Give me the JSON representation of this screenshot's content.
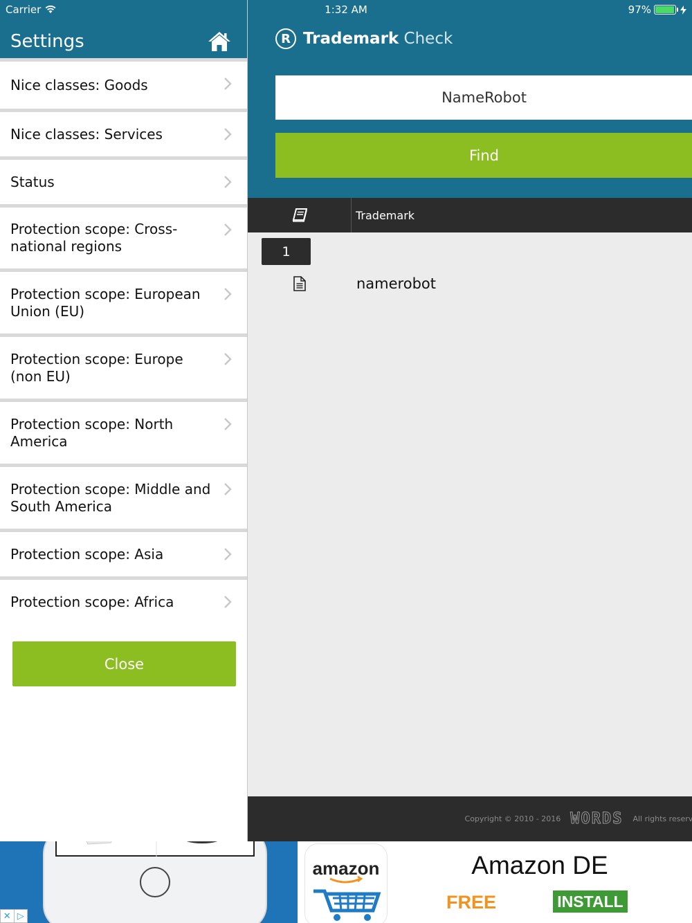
{
  "status_bar": {
    "carrier": "Carrier",
    "time": "1:32 AM",
    "battery": "97%",
    "battery_level": 0.97
  },
  "sidebar": {
    "title": "Settings",
    "items": [
      {
        "label": "Nice classes: Goods"
      },
      {
        "label": "Nice classes: Services"
      },
      {
        "label": "Status"
      },
      {
        "label": "Protection scope: Cross-national regions"
      },
      {
        "label": "Protection scope: European Union (EU)"
      },
      {
        "label": "Protection scope: Europe (non EU)"
      },
      {
        "label": "Protection scope: North America"
      },
      {
        "label": "Protection scope: Middle and South America"
      },
      {
        "label": "Protection scope: Asia"
      },
      {
        "label": "Protection scope: Africa"
      }
    ],
    "close_label": "Close"
  },
  "main": {
    "logo": {
      "bold": "Trademark",
      "light": "Check"
    },
    "search_value": "NameRobot",
    "find_label": "Find",
    "table": {
      "column_trademark": "Trademark",
      "page": "1",
      "rows": [
        {
          "name": "namerobot"
        }
      ]
    },
    "footer": {
      "copyright": "Copyright © 2010 - 2016",
      "brand": "WORDS",
      "rights": "All rights reserved"
    }
  },
  "ad": {
    "app_logo_text": "amazon",
    "title": "Amazon DE",
    "price": "FREE",
    "install_label": "INSTALL"
  },
  "colors": {
    "header_blue": "#1a6e8e",
    "accent_green": "#8cbd21",
    "dark": "#2c2c2c"
  }
}
